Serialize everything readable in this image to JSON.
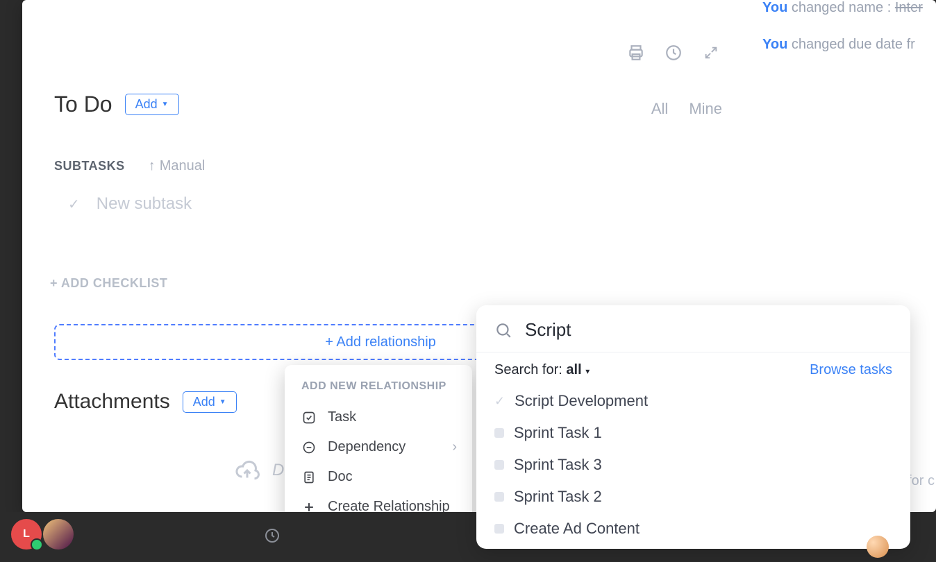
{
  "status": {
    "title": "To Do",
    "add_label": "Add"
  },
  "toolbar": {
    "filter_all": "All",
    "filter_mine": "Mine"
  },
  "activity": [
    {
      "actor": "You",
      "text": "changed name :",
      "strike": "Inter"
    },
    {
      "actor": "You",
      "text": "changed due date fr"
    }
  ],
  "subtasks": {
    "label": "SUBTASKS",
    "sort": "Manual",
    "placeholder": "New subtask"
  },
  "checklist": {
    "add_label": "+ ADD CHECKLIST"
  },
  "relationship": {
    "add_label": "+ Add relationship"
  },
  "attachments": {
    "title": "Attachments",
    "add_label": "Add",
    "dropzone_prefix": "Dr"
  },
  "rel_menu": {
    "header": "ADD NEW RELATIONSHIP",
    "items": [
      {
        "icon": "task",
        "label": "Task"
      },
      {
        "icon": "dependency",
        "label": "Dependency",
        "chevron": true
      },
      {
        "icon": "doc",
        "label": "Doc"
      },
      {
        "icon": "plus",
        "label": "Create Relationship"
      }
    ]
  },
  "search_panel": {
    "query": "Script",
    "search_for_label": "Search for:",
    "scope": "all",
    "browse": "Browse tasks",
    "results": [
      {
        "label": "Script Development",
        "selected": true
      },
      {
        "label": "Sprint Task 1"
      },
      {
        "label": "Sprint Task 3"
      },
      {
        "label": "Sprint Task 2"
      },
      {
        "label": "Create Ad Content"
      }
    ]
  },
  "trunc_right": "for c",
  "bottom": {
    "avatar_initial": "L"
  }
}
